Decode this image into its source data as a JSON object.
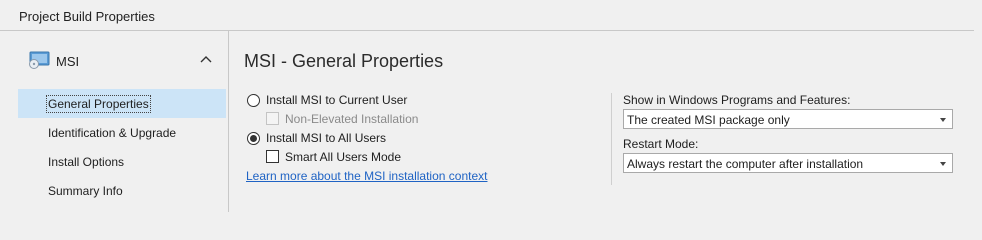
{
  "window": {
    "title": "Project Build Properties"
  },
  "sidebar": {
    "group": {
      "label": "MSI",
      "icon": "msi-package-icon",
      "collapse_icon": "chevron-up-icon"
    },
    "items": [
      {
        "label": "General Properties",
        "selected": true
      },
      {
        "label": "Identification & Upgrade",
        "selected": false
      },
      {
        "label": "Install Options",
        "selected": false
      },
      {
        "label": "Summary Info",
        "selected": false
      }
    ]
  },
  "main": {
    "title": "MSI - General Properties",
    "install_scope": {
      "current_user_label": "Install MSI to Current User",
      "current_user_selected": false,
      "non_elevated_label": "Non-Elevated Installation",
      "non_elevated_checked": false,
      "non_elevated_enabled": false,
      "all_users_label": "Install MSI to All Users",
      "all_users_selected": true,
      "smart_all_users_label": "Smart All Users Mode",
      "smart_all_users_checked": false
    },
    "learn_more_link": "Learn more about the MSI installation context",
    "show_in_programs": {
      "label": "Show in Windows Programs and Features:",
      "value": "The created MSI package only"
    },
    "restart_mode": {
      "label": "Restart Mode:",
      "value": "Always restart the computer after installation"
    }
  },
  "colors": {
    "accent": "#cce4f7",
    "link": "#1f63c4",
    "background": "#f0f0f0"
  }
}
